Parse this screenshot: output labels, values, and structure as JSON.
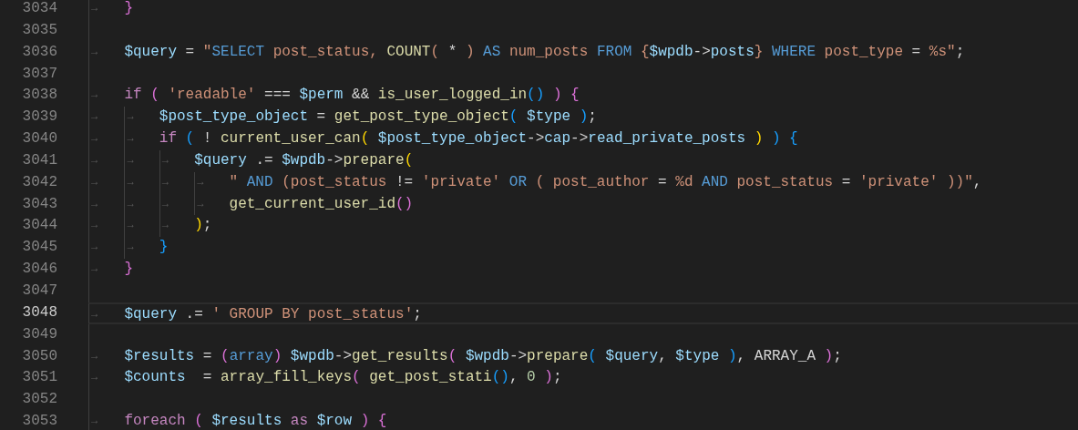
{
  "editor": {
    "lines": [
      {
        "number": "3034",
        "current": false,
        "indent": "→",
        "tokens": [
          {
            "text": "}",
            "kind": "b2"
          }
        ]
      },
      {
        "number": "3035",
        "current": false
      },
      {
        "number": "3036",
        "current": false,
        "indent": "→",
        "tokens": [
          {
            "text": "$query",
            "kind": "var"
          },
          {
            "text": " = ",
            "kind": "op"
          },
          {
            "text": "\"",
            "kind": "str"
          },
          {
            "text": "SELECT",
            "kind": "kw"
          },
          {
            "text": " post_status, ",
            "kind": "str"
          },
          {
            "text": "COUNT",
            "kind": "fn"
          },
          {
            "text": "( ",
            "kind": "str"
          },
          {
            "text": "*",
            "kind": "op"
          },
          {
            "text": " ) ",
            "kind": "str"
          },
          {
            "text": "AS",
            "kind": "kw"
          },
          {
            "text": " num_posts ",
            "kind": "str"
          },
          {
            "text": "FROM",
            "kind": "kw"
          },
          {
            "text": " {",
            "kind": "str"
          },
          {
            "text": "$wpdb",
            "kind": "var"
          },
          {
            "text": "->",
            "kind": "op"
          },
          {
            "text": "posts",
            "kind": "var"
          },
          {
            "text": "} ",
            "kind": "str"
          },
          {
            "text": "WHERE",
            "kind": "kw"
          },
          {
            "text": " post_type ",
            "kind": "str"
          },
          {
            "text": "=",
            "kind": "op"
          },
          {
            "text": " %s\"",
            "kind": "str"
          },
          {
            "text": ";",
            "kind": "op"
          }
        ]
      },
      {
        "number": "3037",
        "current": false
      },
      {
        "number": "3038",
        "current": false,
        "indent": "→",
        "tokens": [
          {
            "text": "if",
            "kind": "ctrl"
          },
          {
            "text": " (",
            "kind": "b2"
          },
          {
            "text": " 'readable'",
            "kind": "str"
          },
          {
            "text": " === ",
            "kind": "op"
          },
          {
            "text": "$perm",
            "kind": "var"
          },
          {
            "text": " && ",
            "kind": "op"
          },
          {
            "text": "is_user_logged_in",
            "kind": "fn"
          },
          {
            "text": "()",
            "kind": "b3"
          },
          {
            "text": " )",
            "kind": "b2"
          },
          {
            "text": " {",
            "kind": "b2"
          }
        ]
      },
      {
        "number": "3039",
        "current": false,
        "indent": [
          "→",
          "→"
        ],
        "tokens": [
          {
            "text": "$post_type_object",
            "kind": "var"
          },
          {
            "text": " = ",
            "kind": "op"
          },
          {
            "text": "get_post_type_object",
            "kind": "fn"
          },
          {
            "text": "(",
            "kind": "b3"
          },
          {
            "text": " $type",
            "kind": "var"
          },
          {
            "text": " )",
            "kind": "b3"
          },
          {
            "text": ";",
            "kind": "op"
          }
        ]
      },
      {
        "number": "3040",
        "current": false,
        "indent": [
          "→",
          "→"
        ],
        "tokens": [
          {
            "text": "if",
            "kind": "ctrl"
          },
          {
            "text": " (",
            "kind": "b3"
          },
          {
            "text": " ! ",
            "kind": "op"
          },
          {
            "text": "current_user_can",
            "kind": "fn"
          },
          {
            "text": "(",
            "kind": "b1"
          },
          {
            "text": " $post_type_object",
            "kind": "var"
          },
          {
            "text": "->",
            "kind": "op"
          },
          {
            "text": "cap",
            "kind": "var"
          },
          {
            "text": "->",
            "kind": "op"
          },
          {
            "text": "read_private_posts",
            "kind": "var"
          },
          {
            "text": " )",
            "kind": "b1"
          },
          {
            "text": " )",
            "kind": "b3"
          },
          {
            "text": " {",
            "kind": "b3"
          }
        ]
      },
      {
        "number": "3041",
        "current": false,
        "indent": [
          "→",
          "→",
          "→"
        ],
        "tokens": [
          {
            "text": "$query",
            "kind": "var"
          },
          {
            "text": " .= ",
            "kind": "op"
          },
          {
            "text": "$wpdb",
            "kind": "var"
          },
          {
            "text": "->",
            "kind": "op"
          },
          {
            "text": "prepare",
            "kind": "fn"
          },
          {
            "text": "(",
            "kind": "b1"
          }
        ]
      },
      {
        "number": "3042",
        "current": false,
        "indent": [
          "→",
          "→",
          "→",
          "→"
        ],
        "tokens": [
          {
            "text": "\" ",
            "kind": "str"
          },
          {
            "text": "AND",
            "kind": "kw"
          },
          {
            "text": " (post_status ",
            "kind": "str"
          },
          {
            "text": "!=",
            "kind": "op"
          },
          {
            "text": " 'private' ",
            "kind": "str"
          },
          {
            "text": "OR",
            "kind": "kw"
          },
          {
            "text": " ( post_author ",
            "kind": "str"
          },
          {
            "text": "=",
            "kind": "op"
          },
          {
            "text": " %d ",
            "kind": "str"
          },
          {
            "text": "AND",
            "kind": "kw"
          },
          {
            "text": " post_status ",
            "kind": "str"
          },
          {
            "text": "=",
            "kind": "op"
          },
          {
            "text": " 'private' ))\"",
            "kind": "str"
          },
          {
            "text": ",",
            "kind": "op"
          }
        ]
      },
      {
        "number": "3043",
        "current": false,
        "indent": [
          "→",
          "→",
          "→",
          "→"
        ],
        "tokens": [
          {
            "text": "get_current_user_id",
            "kind": "fn"
          },
          {
            "text": "()",
            "kind": "b2"
          }
        ]
      },
      {
        "number": "3044",
        "current": false,
        "indent": [
          "→",
          "→",
          "→"
        ],
        "tokens": [
          {
            "text": ")",
            "kind": "b1"
          },
          {
            "text": ";",
            "kind": "op"
          }
        ]
      },
      {
        "number": "3045",
        "current": false,
        "indent": [
          "→",
          "→"
        ],
        "tokens": [
          {
            "text": "}",
            "kind": "b3"
          }
        ]
      },
      {
        "number": "3046",
        "current": false,
        "indent": "→",
        "tokens": [
          {
            "text": "}",
            "kind": "b2"
          }
        ]
      },
      {
        "number": "3047",
        "current": false
      },
      {
        "number": "3048",
        "current": true,
        "indent": "→",
        "tokens": [
          {
            "text": "$query",
            "kind": "var"
          },
          {
            "text": " .= ",
            "kind": "op"
          },
          {
            "text": "' GROUP BY post_status'",
            "kind": "str"
          },
          {
            "text": ";",
            "kind": "op"
          }
        ]
      },
      {
        "number": "3049",
        "current": false
      },
      {
        "number": "3050",
        "current": false,
        "indent": "→",
        "tokens": [
          {
            "text": "$results",
            "kind": "var"
          },
          {
            "text": " = ",
            "kind": "op"
          },
          {
            "text": "(",
            "kind": "b2"
          },
          {
            "text": "array",
            "kind": "kw"
          },
          {
            "text": ")",
            "kind": "b2"
          },
          {
            "text": " $wpdb",
            "kind": "var"
          },
          {
            "text": "->",
            "kind": "op"
          },
          {
            "text": "get_results",
            "kind": "fn"
          },
          {
            "text": "(",
            "kind": "b2"
          },
          {
            "text": " $wpdb",
            "kind": "var"
          },
          {
            "text": "->",
            "kind": "op"
          },
          {
            "text": "prepare",
            "kind": "fn"
          },
          {
            "text": "(",
            "kind": "b3"
          },
          {
            "text": " $query",
            "kind": "var"
          },
          {
            "text": ", ",
            "kind": "op"
          },
          {
            "text": "$type",
            "kind": "var"
          },
          {
            "text": " )",
            "kind": "b3"
          },
          {
            "text": ", ARRAY_A",
            "kind": "op"
          },
          {
            "text": " )",
            "kind": "b2"
          },
          {
            "text": ";",
            "kind": "op"
          }
        ]
      },
      {
        "number": "3051",
        "current": false,
        "indent": "→",
        "tokens": [
          {
            "text": "$counts",
            "kind": "var"
          },
          {
            "text": "  = ",
            "kind": "op"
          },
          {
            "text": "array_fill_keys",
            "kind": "fn"
          },
          {
            "text": "(",
            "kind": "b2"
          },
          {
            "text": " get_post_stati",
            "kind": "fn"
          },
          {
            "text": "()",
            "kind": "b3"
          },
          {
            "text": ", ",
            "kind": "op"
          },
          {
            "text": "0",
            "kind": "num"
          },
          {
            "text": " )",
            "kind": "b2"
          },
          {
            "text": ";",
            "kind": "op"
          }
        ]
      },
      {
        "number": "3052",
        "current": false
      },
      {
        "number": "3053",
        "current": false,
        "indent": "→",
        "tokens": [
          {
            "text": "foreach",
            "kind": "ctrl"
          },
          {
            "text": " (",
            "kind": "b2"
          },
          {
            "text": " $results",
            "kind": "var"
          },
          {
            "text": " as",
            "kind": "ctrl"
          },
          {
            "text": " $row",
            "kind": "var"
          },
          {
            "text": " )",
            "kind": "b2"
          },
          {
            "text": " {",
            "kind": "b2"
          }
        ]
      }
    ]
  }
}
